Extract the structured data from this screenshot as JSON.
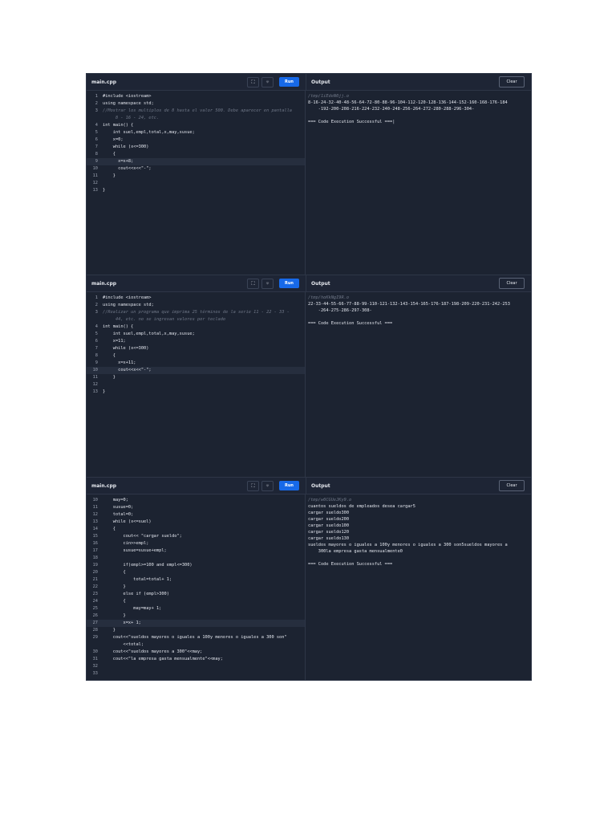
{
  "panels": [
    {
      "tab": "main.cpp",
      "run_label": "Run",
      "output_label": "Output",
      "clear_label": "Clear",
      "fullscreen_icon": "⛶",
      "theme_icon": "☼",
      "code": [
        {
          "n": "1",
          "t": "#include <iostream>"
        },
        {
          "n": "2",
          "t": "using namespace std;"
        },
        {
          "n": "3",
          "t": "//Mostrar los multiplos de 8 hasta el valor 500. Debe aparecer en pantalla"
        },
        {
          "n": "",
          "t": "     8 - 16 - 24, etc."
        },
        {
          "n": "4",
          "t": "int main() {"
        },
        {
          "n": "5",
          "t": "    int suel,empl,total,x,may,susue;"
        },
        {
          "n": "6",
          "t": "    x=0;"
        },
        {
          "n": "7",
          "t": "    while (x<=300)"
        },
        {
          "n": "8",
          "t": "    {"
        },
        {
          "n": "9",
          "t": "      x=x+8;"
        },
        {
          "n": "10",
          "t": "      cout<<x<<\"-\";"
        },
        {
          "n": "11",
          "t": "    }"
        },
        {
          "n": "12",
          "t": ""
        },
        {
          "n": "13",
          "t": "}"
        }
      ],
      "output": [
        {
          "t": "/tmp/1iEdeN0jj.o",
          "path": true
        },
        {
          "t": "8-16-24-32-40-48-56-64-72-80-88-96-104-112-120-128-136-144-152-160-168-176-184",
          "path": false
        },
        {
          "t": "    -192-200-208-216-224-232-240-248-256-264-272-280-288-296-304-",
          "path": false
        },
        {
          "t": "",
          "path": false
        },
        {
          "t": "=== Code Execution Successful ===|",
          "path": false
        }
      ]
    },
    {
      "tab": "main.cpp",
      "run_label": "Run",
      "output_label": "Output",
      "clear_label": "Clear",
      "fullscreen_icon": "⛶",
      "theme_icon": "☼",
      "code": [
        {
          "n": "1",
          "t": "#include <iostream>"
        },
        {
          "n": "2",
          "t": "using namespace std;"
        },
        {
          "n": "3",
          "t": "//Realizar un programa que imprima 25 términos de la serie 11 - 22 - 33 -"
        },
        {
          "n": "",
          "t": "     44, etc. no se ingresan valores por teclado"
        },
        {
          "n": "4",
          "t": "int main() {"
        },
        {
          "n": "5",
          "t": "    int suel,empl,total,x,may,susue;"
        },
        {
          "n": "6",
          "t": "    x=11;"
        },
        {
          "n": "7",
          "t": "    while (x<=300)"
        },
        {
          "n": "8",
          "t": "    {"
        },
        {
          "n": "9",
          "t": "      x=x+11;"
        },
        {
          "n": "10",
          "t": "      cout<<x<<\"-\";"
        },
        {
          "n": "11",
          "t": "    }"
        },
        {
          "n": "12",
          "t": ""
        },
        {
          "n": "13",
          "t": "}"
        }
      ],
      "output": [
        {
          "t": "/tmp/hoKkNgI9R.o",
          "path": true
        },
        {
          "t": "22-33-44-55-66-77-88-99-110-121-132-143-154-165-176-187-198-209-220-231-242-253",
          "path": false
        },
        {
          "t": "    -264-275-286-297-308-",
          "path": false
        },
        {
          "t": "",
          "path": false
        },
        {
          "t": "=== Code Execution Successful ===",
          "path": false
        }
      ]
    },
    {
      "tab": "main.cpp",
      "run_label": "Run",
      "output_label": "Output",
      "clear_label": "Clear",
      "fullscreen_icon": "⛶",
      "theme_icon": "☼",
      "code": [
        {
          "n": "10",
          "t": "    may=0;"
        },
        {
          "n": "11",
          "t": "    susue=0;"
        },
        {
          "n": "12",
          "t": "    total=0;"
        },
        {
          "n": "13",
          "t": "    while (x<=suel)"
        },
        {
          "n": "14",
          "t": "    {"
        },
        {
          "n": "15",
          "t": "        cout<< \"cargar sueldo\";"
        },
        {
          "n": "16",
          "t": "        cin>>empl;"
        },
        {
          "n": "17",
          "t": "        susue=susue+empl;"
        },
        {
          "n": "18",
          "t": ""
        },
        {
          "n": "19",
          "t": "        if(empl>=100 and empl<=300)"
        },
        {
          "n": "20",
          "t": "        {"
        },
        {
          "n": "21",
          "t": "            total=total+ 1;"
        },
        {
          "n": "22",
          "t": "        }"
        },
        {
          "n": "23",
          "t": "        else if (empl>300)"
        },
        {
          "n": "24",
          "t": "        {"
        },
        {
          "n": "25",
          "t": "            may=may+ 1;"
        },
        {
          "n": "26",
          "t": "        }"
        },
        {
          "n": "27",
          "t": "        x=x+ 1;"
        },
        {
          "n": "28",
          "t": "    }"
        },
        {
          "n": "29",
          "t": "    cout<<\"sueldos mayores o iguales a 100y menores o iguales a 300 son\""
        },
        {
          "n": "",
          "t": "        <<total;"
        },
        {
          "n": "30",
          "t": "    cout<<\"sueldos mayores a 300\"<<may;"
        },
        {
          "n": "31",
          "t": "    cout<<\"la empresa gasta mensualmente\"<<may;"
        },
        {
          "n": "32",
          "t": ""
        },
        {
          "n": "33",
          "t": ""
        }
      ],
      "output": [
        {
          "t": "/tmp/w0CGUeJKy9.o",
          "path": true
        },
        {
          "t": "cuantos sueldos de empleados desea cargar5",
          "path": false
        },
        {
          "t": "cargar sueldo300",
          "path": false
        },
        {
          "t": "cargar sueldo200",
          "path": false
        },
        {
          "t": "cargar sueldo100",
          "path": false
        },
        {
          "t": "cargar sueldo120",
          "path": false
        },
        {
          "t": "cargar sueldo130",
          "path": false
        },
        {
          "t": "sueldos mayores o iguales a 100y menores o iguales a 300 son5sueldos mayores a",
          "path": false
        },
        {
          "t": "    300la empresa gasta mensualmente0",
          "path": false
        },
        {
          "t": "",
          "path": false
        },
        {
          "t": "=== Code Execution Successful ===",
          "path": false
        }
      ]
    }
  ]
}
